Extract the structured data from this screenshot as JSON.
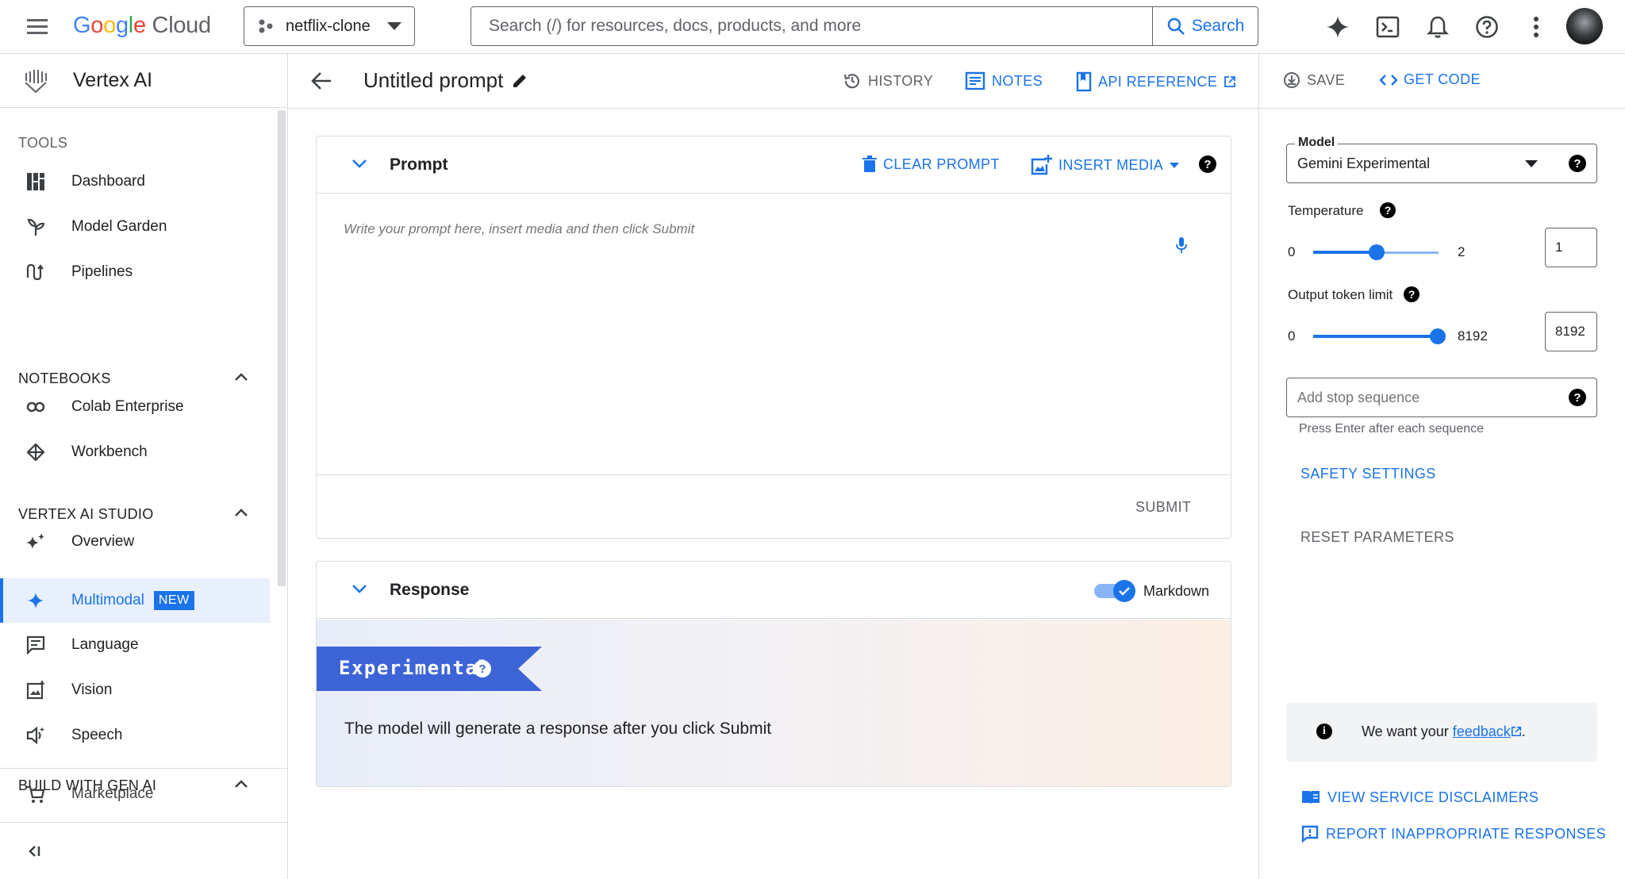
{
  "topbar": {
    "brand": "Google Cloud",
    "project": "netflix-clone",
    "search_placeholder": "Search (/) for resources, docs, products, and more",
    "search_button": "Search"
  },
  "sidebar": {
    "product_title": "Vertex AI",
    "tools_label": "TOOLS",
    "tools": [
      {
        "label": "Dashboard",
        "icon": "dashboard-icon"
      },
      {
        "label": "Model Garden",
        "icon": "model-garden-icon"
      },
      {
        "label": "Pipelines",
        "icon": "pipelines-icon"
      }
    ],
    "notebooks_label": "NOTEBOOKS",
    "notebooks": [
      {
        "label": "Colab Enterprise",
        "icon": "colab-icon"
      },
      {
        "label": "Workbench",
        "icon": "workbench-icon"
      }
    ],
    "studio_label": "VERTEX AI STUDIO",
    "studio": [
      {
        "label": "Overview",
        "icon": "sparkle-overview-icon"
      },
      {
        "label": "Multimodal",
        "icon": "sparkle-icon",
        "badge": "NEW",
        "active": true
      },
      {
        "label": "Language",
        "icon": "language-icon"
      },
      {
        "label": "Vision",
        "icon": "vision-icon"
      },
      {
        "label": "Speech",
        "icon": "speech-icon"
      }
    ],
    "build_label": "BUILD WITH GEN AI",
    "marketplace": "Marketplace"
  },
  "header": {
    "prompt_title": "Untitled prompt",
    "history": "HISTORY",
    "notes": "NOTES",
    "api_reference": "API REFERENCE",
    "save": "SAVE",
    "get_code": "GET CODE"
  },
  "prompt_card": {
    "title": "Prompt",
    "clear": "CLEAR PROMPT",
    "insert_media": "INSERT MEDIA",
    "placeholder": "Write your prompt here, insert media and then click Submit",
    "submit": "SUBMIT"
  },
  "response_card": {
    "title": "Response",
    "markdown_label": "Markdown",
    "markdown_on": true,
    "banner": "Experimental",
    "message": "The model will generate a response after you click Submit"
  },
  "params": {
    "model_label": "Model",
    "model_value": "Gemini Experimental",
    "temperature_label": "Temperature",
    "temperature_min": "0",
    "temperature_max": "2",
    "temperature_value": "1",
    "token_label": "Output token limit",
    "token_min": "0",
    "token_max": "8192",
    "token_value": "8192",
    "stop_placeholder": "Add stop sequence",
    "stop_hint": "Press Enter after each sequence",
    "safety": "SAFETY SETTINGS",
    "reset": "RESET PARAMETERS",
    "feedback_prefix": "We want your",
    "feedback_link": "feedback",
    "feedback_suffix": ".",
    "disclaimers": "VIEW SERVICE DISCLAIMERS",
    "report": "REPORT INAPPROPRIATE RESPONSES"
  },
  "colors": {
    "accent": "#1a73e8",
    "border": "#dadce0",
    "text_secondary": "#5f6368",
    "banner": "#3d64d6"
  }
}
